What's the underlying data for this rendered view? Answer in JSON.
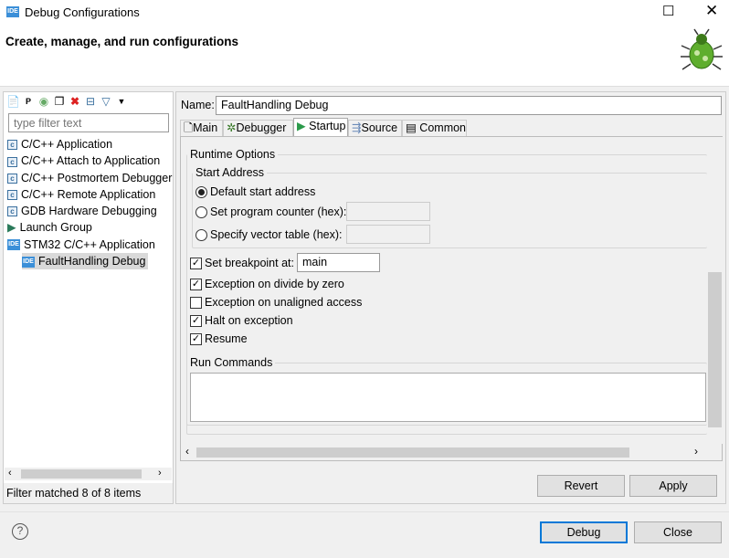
{
  "window": {
    "title": "Debug Configurations",
    "app_icon": "IDE",
    "subtitle": "Create, manage, and run configurations"
  },
  "left": {
    "filter_placeholder": "type filter text",
    "status": "Filter matched 8 of 8 items",
    "items": [
      {
        "label": "C/C++ Application",
        "icon": "c-icon"
      },
      {
        "label": "C/C++ Attach to Application",
        "icon": "c-icon"
      },
      {
        "label": "C/C++ Postmortem Debugger",
        "icon": "c-icon"
      },
      {
        "label": "C/C++ Remote Application",
        "icon": "c-icon"
      },
      {
        "label": "GDB Hardware Debugging",
        "icon": "c-icon"
      },
      {
        "label": "Launch Group",
        "icon": "launch-group-icon"
      },
      {
        "label": "STM32 C/C++ Application",
        "icon": "IDE"
      },
      {
        "label": "FaultHandling Debug",
        "icon": "IDE",
        "selected": true
      }
    ]
  },
  "config": {
    "name_label": "Name:",
    "name_value": "FaultHandling Debug",
    "tabs": [
      "Main",
      "Debugger",
      "Startup",
      "Source",
      "Common"
    ],
    "active_tab": "Startup",
    "runtime_options": "Runtime Options",
    "start_address": "Start Address",
    "radios": [
      "Default start address",
      "Set program counter (hex):",
      "Specify vector table (hex):"
    ],
    "breakpoint_label": "Set breakpoint at:",
    "breakpoint_value": "main",
    "checks": [
      {
        "label": "Exception on divide by zero",
        "checked": true
      },
      {
        "label": "Exception on unaligned access",
        "checked": false
      },
      {
        "label": "Halt on exception",
        "checked": true
      },
      {
        "label": "Resume",
        "checked": true
      }
    ],
    "run_commands": "Run Commands"
  },
  "buttons": {
    "revert": "Revert",
    "apply": "Apply",
    "debug": "Debug",
    "close": "Close",
    "help": "?"
  }
}
